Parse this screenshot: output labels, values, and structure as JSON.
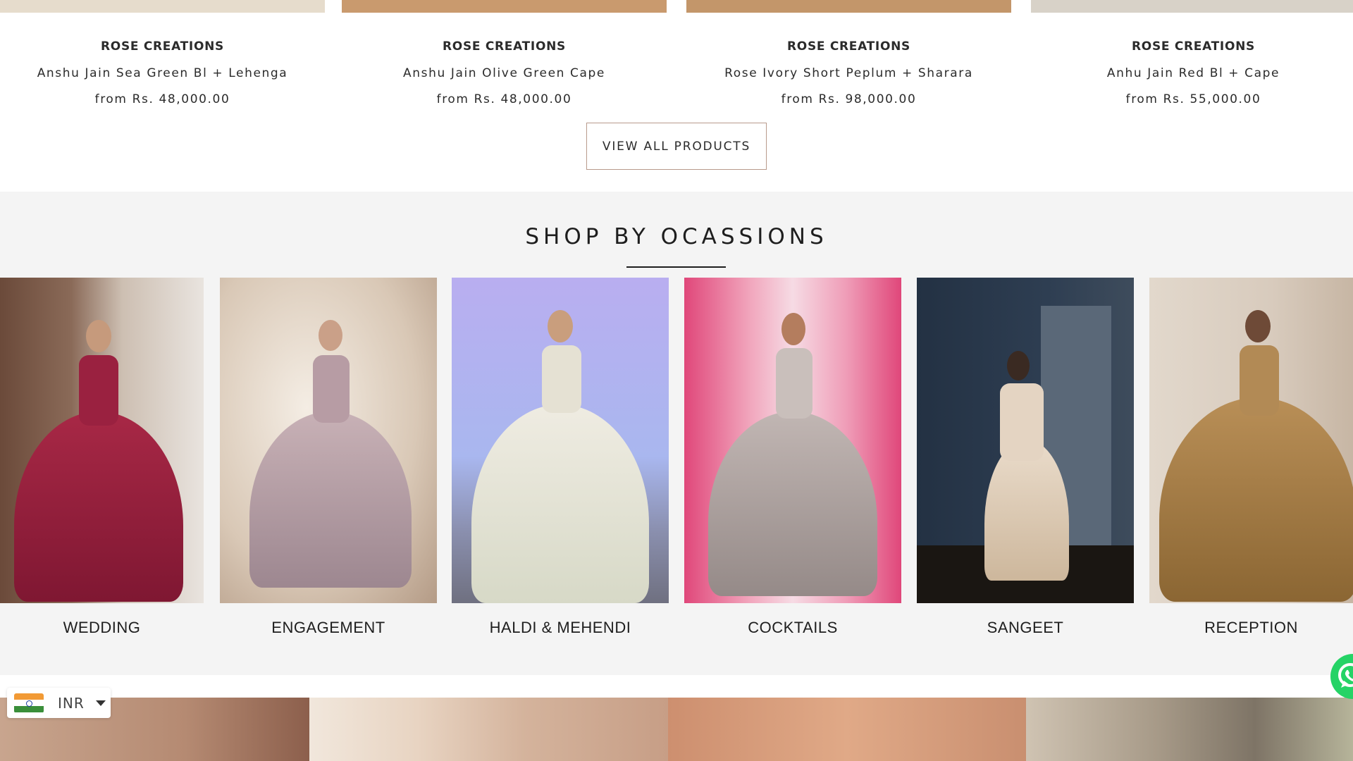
{
  "products": [
    {
      "brand": "ROSE CREATIONS",
      "name": "Anshu Jain Sea Green Bl + Lehenga",
      "price": "from Rs. 48,000.00"
    },
    {
      "brand": "ROSE CREATIONS",
      "name": "Anshu Jain Olive Green Cape",
      "price": "from Rs. 48,000.00"
    },
    {
      "brand": "ROSE CREATIONS",
      "name": "Rose Ivory Short Peplum + Sharara",
      "price": "from Rs. 98,000.00"
    },
    {
      "brand": "ROSE CREATIONS",
      "name": "Anhu Jain Red Bl + Cape",
      "price": "from Rs. 55,000.00"
    }
  ],
  "view_all_label": "VIEW ALL PRODUCTS",
  "occasions": {
    "title": "SHOP BY OCASSIONS",
    "items": [
      {
        "label": "WEDDING"
      },
      {
        "label": "ENGAGEMENT"
      },
      {
        "label": "HALDI & MEHENDI"
      },
      {
        "label": "COCKTAILS"
      },
      {
        "label": "SANGEET"
      },
      {
        "label": "RECEPTION"
      }
    ]
  },
  "currency": {
    "code": "INR",
    "flag_icon": "india-flag-icon"
  },
  "chat": {
    "icon": "whatsapp-icon",
    "color": "#25d366"
  },
  "colors": {
    "accent_border": "#b89a8c",
    "section_bg": "#f4f4f4"
  }
}
